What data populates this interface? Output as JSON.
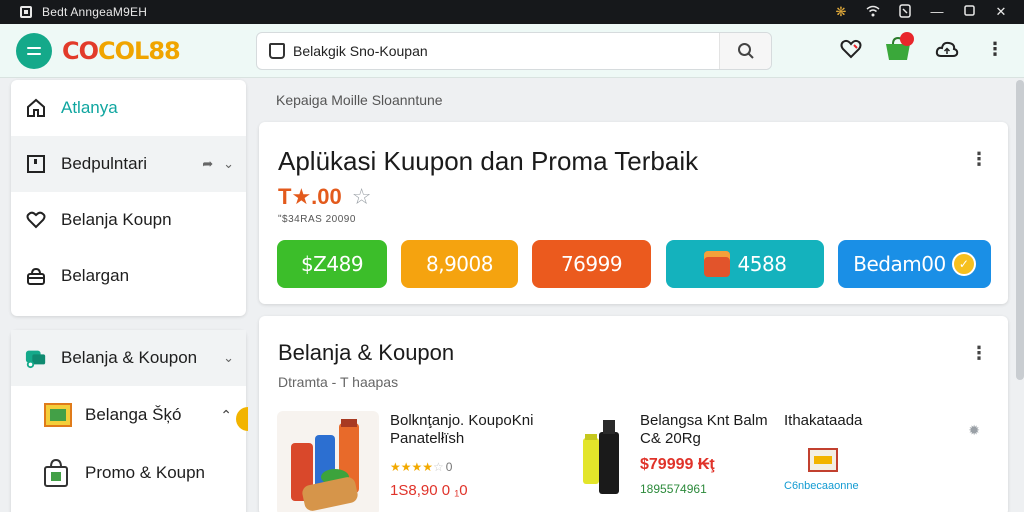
{
  "window": {
    "title": "Bedt AnngeaM9EH",
    "icons": [
      "settings-icon",
      "wifi-icon",
      "phone-icon",
      "minimize-icon",
      "maximize-icon",
      "close-icon"
    ]
  },
  "header": {
    "logo_part1": "CO",
    "logo_part2": "COL88",
    "search_placeholder": "Belakgik Sno-Koupan",
    "icons": [
      "wishlist-icon",
      "cart-icon",
      "cloud-icon",
      "more-icon"
    ]
  },
  "sidebar": {
    "items": [
      {
        "label": "Atlanya",
        "icon": "home-icon",
        "active": true
      },
      {
        "label": "Bedpulntari",
        "icon": "square-icon"
      },
      {
        "label": "Belanja Koupn",
        "icon": "heart-icon"
      },
      {
        "label": "Belargan",
        "icon": "bag-icon"
      }
    ],
    "section": {
      "label": "Belanja & Koupon",
      "icon": "truck-icon",
      "children": [
        {
          "label": "Belanga Šķó",
          "icon": "coupon-icon"
        },
        {
          "label": "Promo & Koupn",
          "icon": "shopping-bag-icon"
        }
      ]
    }
  },
  "breadcrumb": "Kepaiga Moille Sloanntune",
  "hero": {
    "title": "Aplükasi Kuupon dan Proma Terbaik",
    "price": "T★.00",
    "price_sub": "ʺ$34RAS 20090",
    "buttons": [
      {
        "label": "$Z489",
        "color": "#3cbe2a"
      },
      {
        "label": "8,9008",
        "color": "#f5a30f"
      },
      {
        "label": "76999",
        "color": "#eb5a1e"
      },
      {
        "label": "4588",
        "color": "#14b2bd"
      },
      {
        "label": "Bedam00",
        "color": "#1a8fe6"
      }
    ]
  },
  "list": {
    "title": "Belanja & Koupon",
    "subtitle": "Dtramta - T haapas",
    "products": [
      {
        "name": "Bolknţanjo. KoupoKni Panatelłïsh",
        "rating": 4,
        "rating_count": "0",
        "price": "1S8,90 0 ₁0"
      },
      {
        "name": "Belangsa Knt Balm C& 20Rg",
        "price": "$79999 ₭ţ",
        "meta": "1895574961"
      },
      {
        "name": "Ithakataada",
        "meta": "C6nbecaaonne"
      }
    ]
  }
}
